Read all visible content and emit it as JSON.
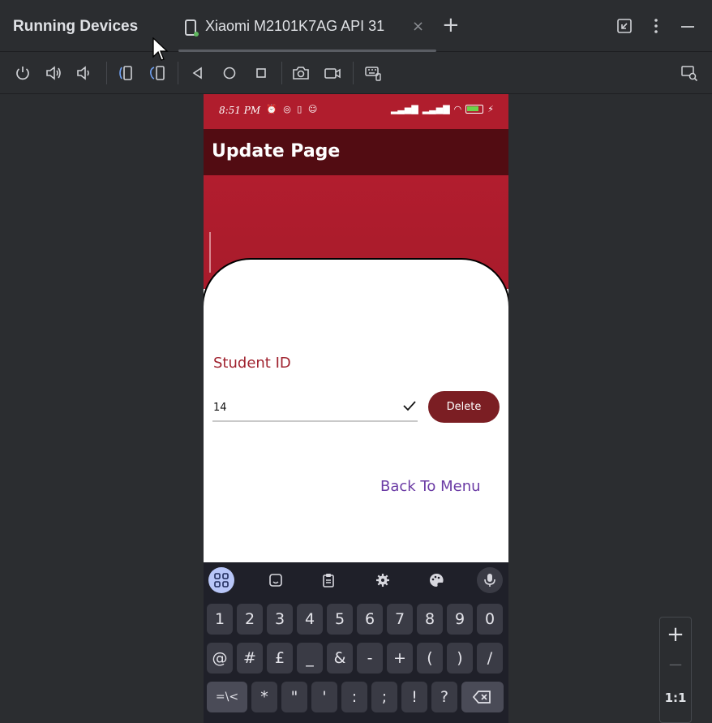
{
  "ide": {
    "panel_title": "Running Devices",
    "tab_label": "Xiaomi M2101K7AG API 31",
    "tab_close": "×",
    "add_tab": "+",
    "zoom_in": "+",
    "zoom_out": "—",
    "zoom_ratio": "1:1"
  },
  "phone": {
    "status_time": "8:51 PM",
    "app_title": "Update Page",
    "student_label": "Student ID",
    "student_id_value": "14",
    "delete_label": "Delete",
    "back_label": "Back To Menu"
  },
  "keyboard": {
    "row1": [
      "1",
      "2",
      "3",
      "4",
      "5",
      "6",
      "7",
      "8",
      "9",
      "0"
    ],
    "row2": [
      "@",
      "#",
      "£",
      "_",
      "&",
      "-",
      "+",
      "(",
      ")",
      "/"
    ],
    "row3": [
      "*",
      "\"",
      "'",
      ":",
      ";",
      "!",
      "?"
    ],
    "mode_key": "=\\<"
  },
  "colors": {
    "status_bar": "#b01d2d",
    "app_bar": "#520c12",
    "accent_red": "#a0232f",
    "delete_button": "#7b1e23",
    "link_purple": "#6a3aa4"
  }
}
